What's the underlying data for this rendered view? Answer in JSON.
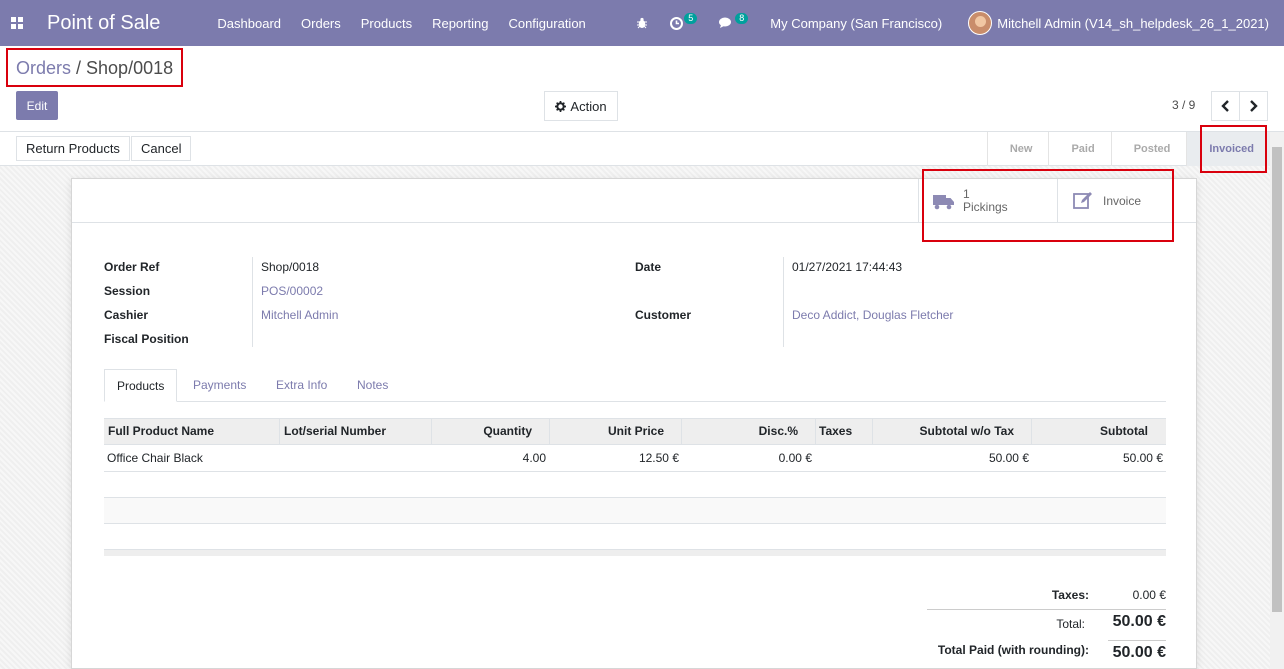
{
  "navbar": {
    "app_title": "Point of Sale",
    "menu": [
      "Dashboard",
      "Orders",
      "Products",
      "Reporting",
      "Configuration"
    ],
    "activity_count": "5",
    "messages_count": "8",
    "company": "My Company (San Francisco)",
    "user": "Mitchell Admin (V14_sh_helpdesk_26_1_2021)"
  },
  "breadcrumb": {
    "parent": "Orders",
    "separator": " / ",
    "current": "Shop/0018"
  },
  "control": {
    "edit_label": "Edit",
    "action_label": "Action",
    "pager": "3 / 9"
  },
  "statusbar": {
    "return_label": "Return Products",
    "cancel_label": "Cancel",
    "stages": [
      "New",
      "Paid",
      "Posted",
      "Invoiced"
    ],
    "active_stage": "Invoiced"
  },
  "smart_buttons": {
    "pickings_count": "1",
    "pickings_label": "Pickings",
    "invoice_label": "Invoice"
  },
  "form": {
    "order_ref_label": "Order Ref",
    "order_ref": "Shop/0018",
    "session_label": "Session",
    "session": "POS/00002",
    "cashier_label": "Cashier",
    "cashier": "Mitchell Admin",
    "fiscal_label": "Fiscal Position",
    "date_label": "Date",
    "date": "01/27/2021 17:44:43",
    "customer_label": "Customer",
    "customer": "Deco Addict, Douglas Fletcher"
  },
  "tabs": [
    "Products",
    "Payments",
    "Extra Info",
    "Notes"
  ],
  "table": {
    "headers": [
      "Full Product Name",
      "Lot/serial Number",
      "Quantity",
      "Unit Price",
      "Disc.%",
      "Taxes",
      "Subtotal w/o Tax",
      "Subtotal"
    ],
    "rows": [
      {
        "name": "Office Chair Black",
        "lot": "",
        "qty": "4.00",
        "price": "12.50 €",
        "disc": "0.00 €",
        "taxes": "",
        "subtotal_wo": "50.00 €",
        "subtotal": "50.00 €"
      }
    ]
  },
  "totals": {
    "taxes_label": "Taxes:",
    "taxes": "0.00 €",
    "total_label": "Total:",
    "total": "50.00 €",
    "paid_label": "Total Paid (with rounding):",
    "paid": "50.00 €"
  }
}
